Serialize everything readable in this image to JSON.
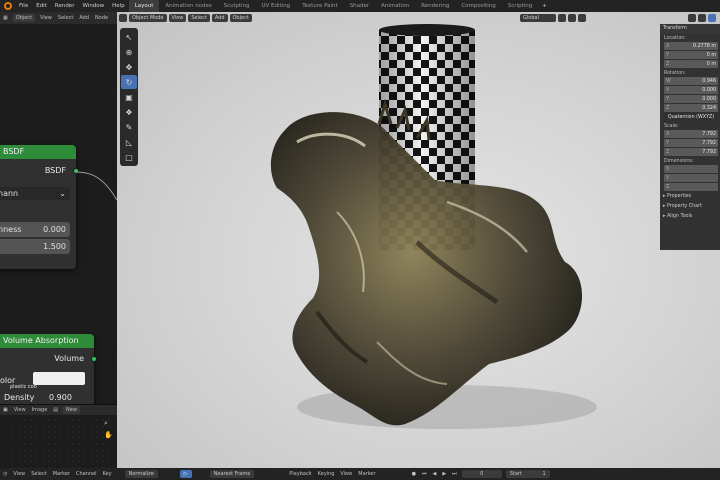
{
  "menubar": {
    "menus": [
      "File",
      "Edit",
      "Render",
      "Window",
      "Help"
    ],
    "workspaces": [
      "Layout",
      "Animation nodes",
      "Sculpting",
      "UV Editing",
      "Texture Paint",
      "Shader",
      "Animation",
      "Rendering",
      "Compositing",
      "Scripting"
    ],
    "active_workspace": "Layout"
  },
  "node_editor": {
    "header": {
      "mode": "Object",
      "menus": [
        "View",
        "Select",
        "Add",
        "Node"
      ]
    },
    "bsdf_node": {
      "title": "BSDF",
      "output": "BSDF",
      "dropdown": "nann",
      "field1_label": "nness",
      "field1_value": "0.000",
      "field2_value": "1.500"
    },
    "volume_node": {
      "title": "Volume Absorption",
      "output": "Volume",
      "color_label": "olor",
      "color_sub": "plastic coo",
      "density_label": "Density",
      "density_value": "0.900"
    }
  },
  "image_editor": {
    "menus": [
      "View",
      "Image"
    ],
    "new_label": "New"
  },
  "viewport": {
    "header": {
      "mode": "Object Mode",
      "menus": [
        "View",
        "Select",
        "Add",
        "Object"
      ],
      "orientation": "Global"
    }
  },
  "npanel": {
    "transform_title": "Transform",
    "location_label": "Location:",
    "location": [
      {
        "k": "X",
        "v": "0.2778 m"
      },
      {
        "k": "Y",
        "v": "0 m"
      },
      {
        "k": "Z",
        "v": "0 m"
      }
    ],
    "rotation_label": "Rotation:",
    "rotation": [
      {
        "k": "W",
        "v": "0.946"
      },
      {
        "k": "X",
        "v": "0.000"
      },
      {
        "k": "Y",
        "v": "0.000"
      },
      {
        "k": "Z",
        "v": "0.324"
      }
    ],
    "rotation_mode": "Quaternion (WXYZ)",
    "scale_label": "Scale:",
    "scale": [
      {
        "k": "X",
        "v": "7.792"
      },
      {
        "k": "Y",
        "v": "7.792"
      },
      {
        "k": "Z",
        "v": "7.792"
      }
    ],
    "dimensions_label": "Dimensions:",
    "dimensions": [
      {
        "k": "X",
        "v": ""
      },
      {
        "k": "Y",
        "v": ""
      },
      {
        "k": "Z",
        "v": ""
      }
    ],
    "sections": [
      "Properties",
      "Property Chart",
      "Align Tools"
    ]
  },
  "statusbar": {
    "left": [
      "View",
      "Select",
      "Marker",
      "Channel",
      "Key"
    ],
    "normalize": "Normalize",
    "nearest_frame": "Nearest Frame",
    "middle": [
      "Playback",
      "Keying",
      "View",
      "Marker"
    ],
    "frame": "0",
    "start_label": "Start",
    "start_value": "1"
  }
}
